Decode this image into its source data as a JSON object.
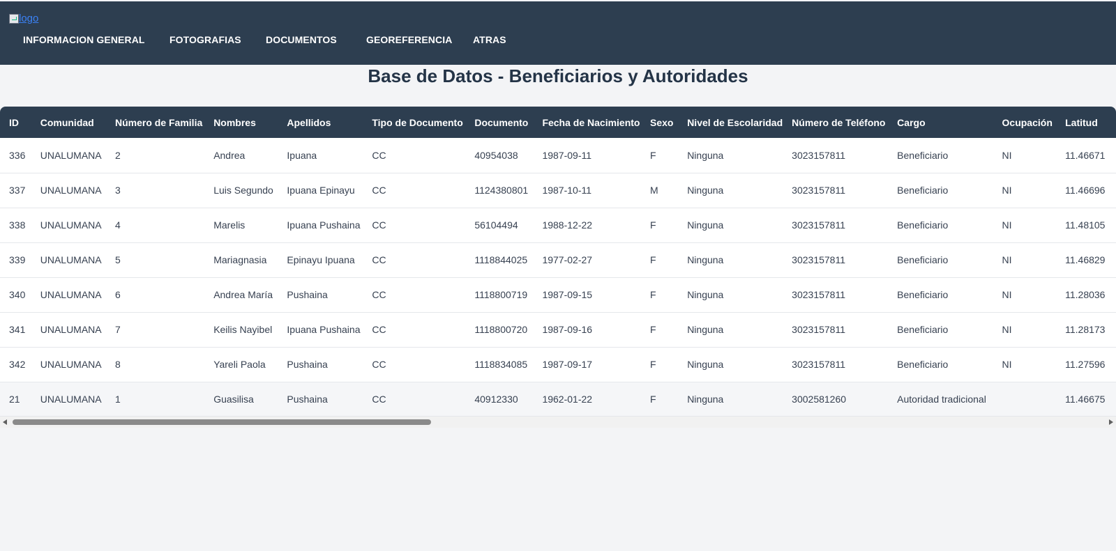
{
  "header": {
    "logo_alt": "logo",
    "nav": [
      {
        "label": "INFORMACION GENERAL"
      },
      {
        "label": "FOTOGRAFIAS"
      },
      {
        "label": "DOCUMENTOS"
      },
      {
        "label": "GEOREFERENCIA"
      },
      {
        "label": "ATRAS"
      }
    ]
  },
  "page": {
    "title": "Base de Datos - Beneficiarios y Autoridades"
  },
  "table": {
    "columns": [
      "ID",
      "Comunidad",
      "Número de Familia",
      "Nombres",
      "Apellidos",
      "Tipo de Documento",
      "Documento",
      "Fecha de Nacimiento",
      "Sexo",
      "Nivel de Escolaridad",
      "Número de Teléfono",
      "Cargo",
      "Ocupación",
      "Latitud"
    ],
    "rows": [
      [
        "336",
        "UNALUMANA",
        "2",
        "Andrea",
        "Ipuana",
        "CC",
        "40954038",
        "1987-09-11",
        "F",
        "Ninguna",
        "3023157811",
        "Beneficiario",
        "NI",
        "11.46671"
      ],
      [
        "337",
        "UNALUMANA",
        "3",
        "Luis Segundo",
        "Ipuana Epinayu",
        "CC",
        "1124380801",
        "1987-10-11",
        "M",
        "Ninguna",
        "3023157811",
        "Beneficiario",
        "NI",
        "11.46696"
      ],
      [
        "338",
        "UNALUMANA",
        "4",
        "Marelis",
        "Ipuana Pushaina",
        "CC",
        "56104494",
        "1988-12-22",
        "F",
        "Ninguna",
        "3023157811",
        "Beneficiario",
        "NI",
        "11.48105"
      ],
      [
        "339",
        "UNALUMANA",
        "5",
        "Mariagnasia",
        "Epinayu Ipuana",
        "CC",
        "1118844025",
        "1977-02-27",
        "F",
        "Ninguna",
        "3023157811",
        "Beneficiario",
        "NI",
        "11.46829"
      ],
      [
        "340",
        "UNALUMANA",
        "6",
        "Andrea María",
        "Pushaina",
        "CC",
        "1118800719",
        "1987-09-15",
        "F",
        "Ninguna",
        "3023157811",
        "Beneficiario",
        "NI",
        "11.28036"
      ],
      [
        "341",
        "UNALUMANA",
        "7",
        "Keilis Nayibel",
        "Ipuana Pushaina",
        "CC",
        "1118800720",
        "1987-09-16",
        "F",
        "Ninguna",
        "3023157811",
        "Beneficiario",
        "NI",
        "11.28173"
      ],
      [
        "342",
        "UNALUMANA",
        "8",
        "Yareli Paola",
        "Pushaina",
        "CC",
        "1118834085",
        "1987-09-17",
        "F",
        "Ninguna",
        "3023157811",
        "Beneficiario",
        "NI",
        "11.27596"
      ],
      [
        "21",
        "UNALUMANA",
        "1",
        "Guasilisa",
        "Pushaina",
        "CC",
        "40912330",
        "1962-01-22",
        "F",
        "Ninguna",
        "3002581260",
        "Autoridad tradicional",
        "",
        "11.46675"
      ]
    ]
  }
}
